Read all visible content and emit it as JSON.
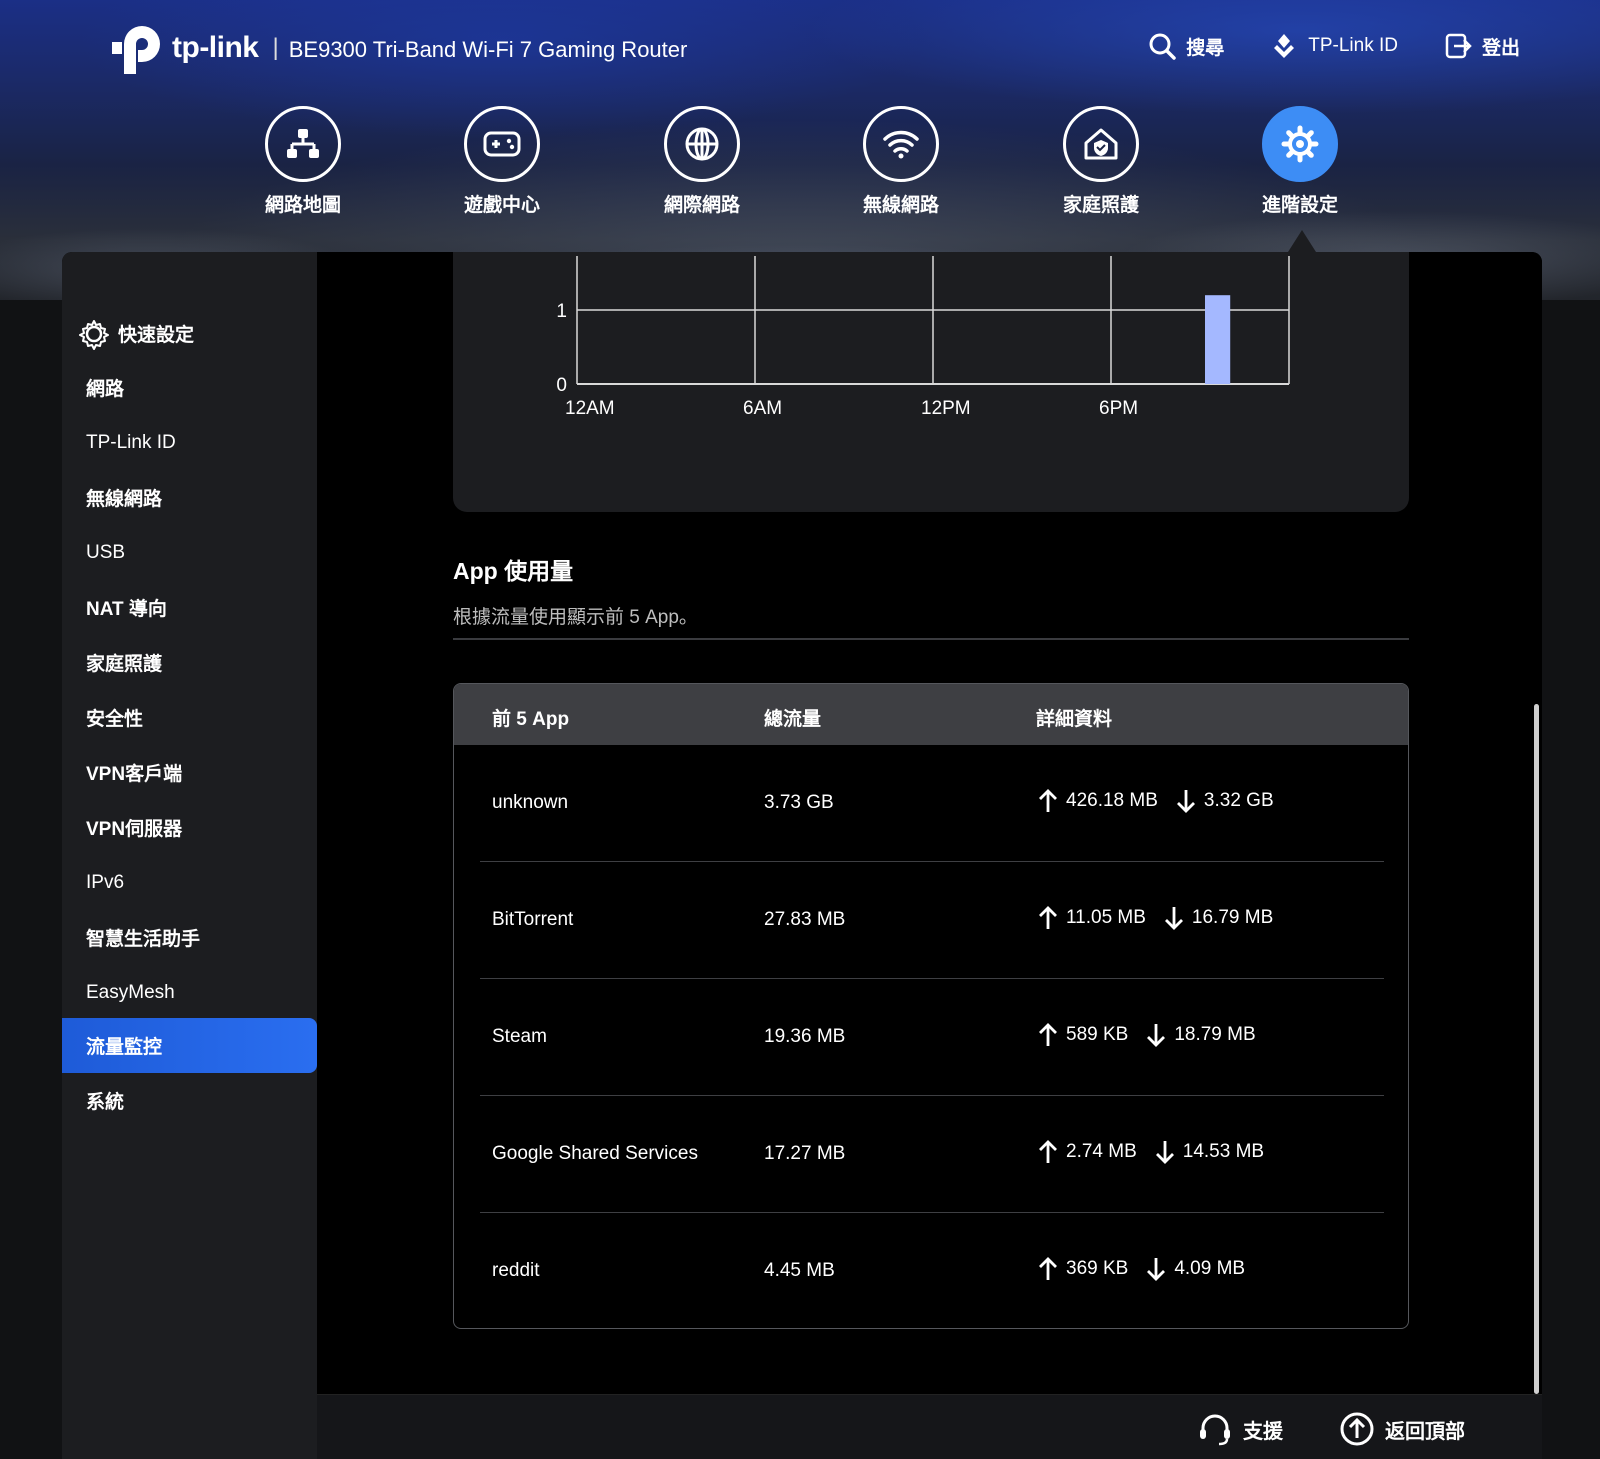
{
  "brand": {
    "logo_text": "tp-link",
    "separator": "|",
    "product": "BE9300 Tri-Band Wi-Fi 7 Gaming Router"
  },
  "top_actions": {
    "search": "搜尋",
    "tplink_id": "TP-Link ID",
    "logout": "登出"
  },
  "nav": {
    "items": [
      {
        "label": "網路地圖",
        "icon": "network-map-icon"
      },
      {
        "label": "遊戲中心",
        "icon": "gamepad-icon"
      },
      {
        "label": "網際網路",
        "icon": "globe-icon"
      },
      {
        "label": "無線網路",
        "icon": "wifi-icon"
      },
      {
        "label": "家庭照護",
        "icon": "home-shield-icon"
      },
      {
        "label": "進階設定",
        "icon": "gear-icon",
        "active": true
      }
    ]
  },
  "sidebar": {
    "items": [
      {
        "label": "快速設定"
      },
      {
        "label": "網路"
      },
      {
        "label": "TP-Link ID"
      },
      {
        "label": "無線網路"
      },
      {
        "label": "USB"
      },
      {
        "label": "NAT 導向"
      },
      {
        "label": "家庭照護"
      },
      {
        "label": "安全性"
      },
      {
        "label": "VPN客戶端"
      },
      {
        "label": "VPN伺服器"
      },
      {
        "label": "IPv6"
      },
      {
        "label": "智慧生活助手"
      },
      {
        "label": "EasyMesh"
      },
      {
        "label": "流量監控",
        "active": true
      },
      {
        "label": "系統"
      }
    ]
  },
  "chart_data": {
    "type": "bar",
    "x_ticks": [
      "12AM",
      "6AM",
      "12PM",
      "6PM"
    ],
    "y_ticks": [
      "0",
      "1"
    ],
    "ylim": [
      0,
      1
    ],
    "hour_range": [
      0,
      24
    ],
    "bars": [
      {
        "hour": 21,
        "value": 1.2
      }
    ],
    "grid": true,
    "colors": {
      "bar": "#a4b8ff",
      "grid": "#d9d9d9"
    }
  },
  "app_usage": {
    "title": "App 使用量",
    "subtitle": "根據流量使用顯示前 5 App。",
    "headers": {
      "app": "前 5 App",
      "total": "總流量",
      "detail": "詳細資料"
    },
    "rows": [
      {
        "app": "unknown",
        "total": "3.73 GB",
        "up": "426.18 MB",
        "down": "3.32 GB"
      },
      {
        "app": "BitTorrent",
        "total": "27.83 MB",
        "up": "11.05 MB",
        "down": "16.79 MB"
      },
      {
        "app": "Steam",
        "total": "19.36 MB",
        "up": "589 KB",
        "down": "18.79 MB"
      },
      {
        "app": "Google Shared Services",
        "total": "17.27 MB",
        "up": "2.74 MB",
        "down": "14.53 MB"
      },
      {
        "app": "reddit",
        "total": "4.45 MB",
        "up": "369 KB",
        "down": "4.09 MB"
      }
    ]
  },
  "footer": {
    "support": "支援",
    "back_to_top": "返回頂部"
  },
  "colors": {
    "accent": "#3d8df5",
    "sidebar_active": "#1e5bd8",
    "panel": "#1c1d20"
  }
}
